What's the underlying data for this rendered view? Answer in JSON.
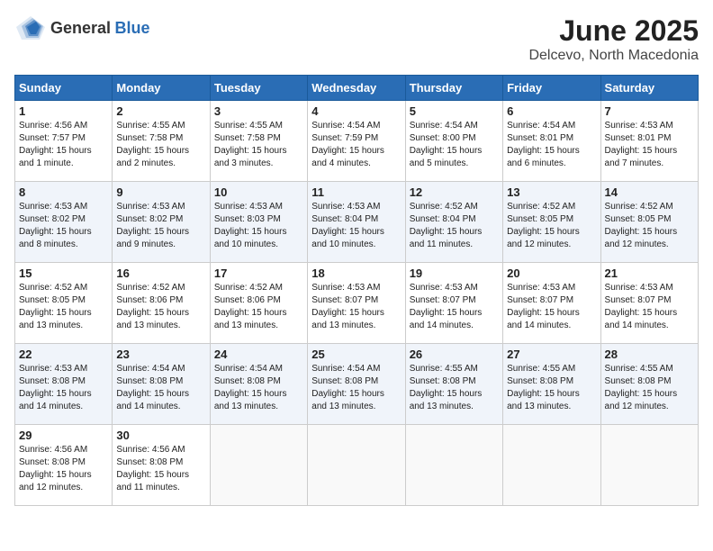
{
  "logo": {
    "general": "General",
    "blue": "Blue"
  },
  "title": "June 2025",
  "location": "Delcevo, North Macedonia",
  "days_header": [
    "Sunday",
    "Monday",
    "Tuesday",
    "Wednesday",
    "Thursday",
    "Friday",
    "Saturday"
  ],
  "weeks": [
    [
      {
        "day": "1",
        "sunrise": "4:56 AM",
        "sunset": "7:57 PM",
        "daylight": "15 hours and 1 minute."
      },
      {
        "day": "2",
        "sunrise": "4:55 AM",
        "sunset": "7:58 PM",
        "daylight": "15 hours and 2 minutes."
      },
      {
        "day": "3",
        "sunrise": "4:55 AM",
        "sunset": "7:58 PM",
        "daylight": "15 hours and 3 minutes."
      },
      {
        "day": "4",
        "sunrise": "4:54 AM",
        "sunset": "7:59 PM",
        "daylight": "15 hours and 4 minutes."
      },
      {
        "day": "5",
        "sunrise": "4:54 AM",
        "sunset": "8:00 PM",
        "daylight": "15 hours and 5 minutes."
      },
      {
        "day": "6",
        "sunrise": "4:54 AM",
        "sunset": "8:01 PM",
        "daylight": "15 hours and 6 minutes."
      },
      {
        "day": "7",
        "sunrise": "4:53 AM",
        "sunset": "8:01 PM",
        "daylight": "15 hours and 7 minutes."
      }
    ],
    [
      {
        "day": "8",
        "sunrise": "4:53 AM",
        "sunset": "8:02 PM",
        "daylight": "15 hours and 8 minutes."
      },
      {
        "day": "9",
        "sunrise": "4:53 AM",
        "sunset": "8:02 PM",
        "daylight": "15 hours and 9 minutes."
      },
      {
        "day": "10",
        "sunrise": "4:53 AM",
        "sunset": "8:03 PM",
        "daylight": "15 hours and 10 minutes."
      },
      {
        "day": "11",
        "sunrise": "4:53 AM",
        "sunset": "8:04 PM",
        "daylight": "15 hours and 10 minutes."
      },
      {
        "day": "12",
        "sunrise": "4:52 AM",
        "sunset": "8:04 PM",
        "daylight": "15 hours and 11 minutes."
      },
      {
        "day": "13",
        "sunrise": "4:52 AM",
        "sunset": "8:05 PM",
        "daylight": "15 hours and 12 minutes."
      },
      {
        "day": "14",
        "sunrise": "4:52 AM",
        "sunset": "8:05 PM",
        "daylight": "15 hours and 12 minutes."
      }
    ],
    [
      {
        "day": "15",
        "sunrise": "4:52 AM",
        "sunset": "8:05 PM",
        "daylight": "15 hours and 13 minutes."
      },
      {
        "day": "16",
        "sunrise": "4:52 AM",
        "sunset": "8:06 PM",
        "daylight": "15 hours and 13 minutes."
      },
      {
        "day": "17",
        "sunrise": "4:52 AM",
        "sunset": "8:06 PM",
        "daylight": "15 hours and 13 minutes."
      },
      {
        "day": "18",
        "sunrise": "4:53 AM",
        "sunset": "8:07 PM",
        "daylight": "15 hours and 13 minutes."
      },
      {
        "day": "19",
        "sunrise": "4:53 AM",
        "sunset": "8:07 PM",
        "daylight": "15 hours and 14 minutes."
      },
      {
        "day": "20",
        "sunrise": "4:53 AM",
        "sunset": "8:07 PM",
        "daylight": "15 hours and 14 minutes."
      },
      {
        "day": "21",
        "sunrise": "4:53 AM",
        "sunset": "8:07 PM",
        "daylight": "15 hours and 14 minutes."
      }
    ],
    [
      {
        "day": "22",
        "sunrise": "4:53 AM",
        "sunset": "8:08 PM",
        "daylight": "15 hours and 14 minutes."
      },
      {
        "day": "23",
        "sunrise": "4:54 AM",
        "sunset": "8:08 PM",
        "daylight": "15 hours and 14 minutes."
      },
      {
        "day": "24",
        "sunrise": "4:54 AM",
        "sunset": "8:08 PM",
        "daylight": "15 hours and 13 minutes."
      },
      {
        "day": "25",
        "sunrise": "4:54 AM",
        "sunset": "8:08 PM",
        "daylight": "15 hours and 13 minutes."
      },
      {
        "day": "26",
        "sunrise": "4:55 AM",
        "sunset": "8:08 PM",
        "daylight": "15 hours and 13 minutes."
      },
      {
        "day": "27",
        "sunrise": "4:55 AM",
        "sunset": "8:08 PM",
        "daylight": "15 hours and 13 minutes."
      },
      {
        "day": "28",
        "sunrise": "4:55 AM",
        "sunset": "8:08 PM",
        "daylight": "15 hours and 12 minutes."
      }
    ],
    [
      {
        "day": "29",
        "sunrise": "4:56 AM",
        "sunset": "8:08 PM",
        "daylight": "15 hours and 12 minutes."
      },
      {
        "day": "30",
        "sunrise": "4:56 AM",
        "sunset": "8:08 PM",
        "daylight": "15 hours and 11 minutes."
      },
      null,
      null,
      null,
      null,
      null
    ]
  ]
}
